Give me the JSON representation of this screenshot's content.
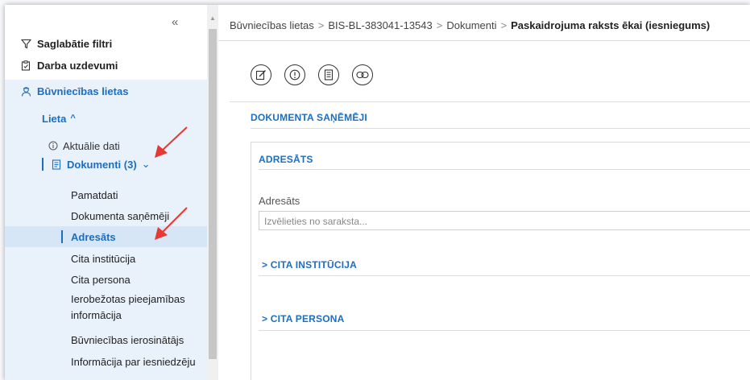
{
  "sidebar": {
    "collapse_icon": "«",
    "items": [
      {
        "label": "Saglabātie filtri",
        "icon": "filter-icon"
      },
      {
        "label": "Darba uzdevumi",
        "icon": "clipboard-icon"
      },
      {
        "label": "Būvniecības lietas",
        "icon": "worker-icon"
      }
    ],
    "lieta": {
      "label": "Lieta",
      "chevron": "^"
    },
    "aktualie": {
      "label": "Aktuālie dati",
      "icon": "info-icon"
    },
    "dokumenti": {
      "label": "Dokumenti (3)",
      "icon": "document-icon",
      "chevron": "⌄"
    },
    "sub_items": [
      "Pamatdati",
      "Dokumenta saņēmēji",
      "Adresāts",
      "Cita institūcija",
      "Cita persona",
      "Ierobežotas pieejamības",
      "informācija",
      "Būvniecības ierosinātājs",
      "Informācija par iesniedzēju"
    ]
  },
  "breadcrumb": {
    "items": [
      "Būvniecības lietas",
      "BIS-BL-383041-13543",
      "Dokumenti"
    ],
    "separator": ">",
    "current": "Paskaidrojuma raksts ēkai (iesniegums)"
  },
  "toolbar": {
    "buttons": [
      "edit-icon",
      "alert-icon",
      "document-list-icon",
      "link-icon"
    ]
  },
  "main": {
    "section_title": "DOKUMENTA SAŅĒMĒJI",
    "panel_title": "ADRESĀTS",
    "field_label": "Adresāts",
    "field_placeholder": "Izvēlieties no saraksta...",
    "cita_institucija": "CITA INSTITŪCIJA",
    "cita_persona": "CITA PERSONA",
    "expand_icon": ">"
  },
  "colors": {
    "accent": "#1b6ec2",
    "highlight": "#e9f1fb",
    "annotation_arrow": "#e53935"
  }
}
